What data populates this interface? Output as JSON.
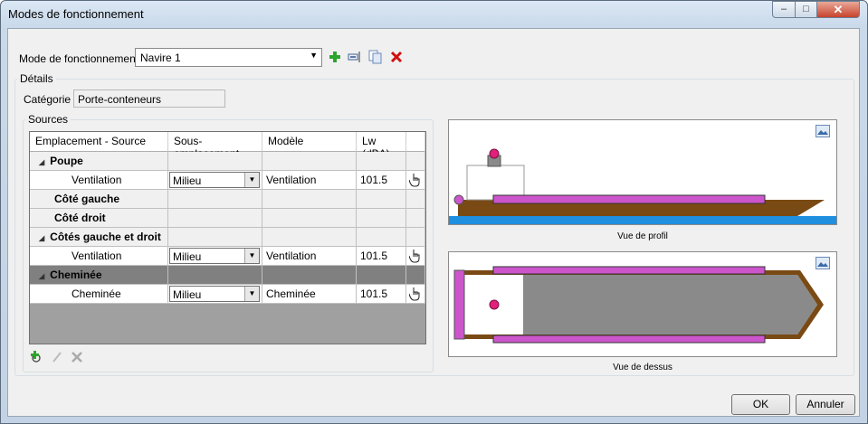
{
  "window": {
    "title": "Modes de fonctionnement",
    "min": "–",
    "max": "□",
    "close": "✕"
  },
  "mode": {
    "label": "Mode de fonctionnement",
    "value": "Navire  1"
  },
  "details": {
    "label": "Détails",
    "category_label": "Catégorie",
    "category_value": "Porte-conteneurs"
  },
  "sources": {
    "label": "Sources",
    "columns": [
      "Emplacement - Source",
      "Sous-emplacement",
      "Modèle",
      "Lw (dBA)"
    ],
    "rows": [
      {
        "kind": "group",
        "name": "Poupe",
        "expander": "◢"
      },
      {
        "kind": "item",
        "name": "Ventilation",
        "sub": "Milieu",
        "model": "Ventilation",
        "lw": "101.5"
      },
      {
        "kind": "group",
        "name": "Côté gauche",
        "expander": ""
      },
      {
        "kind": "group",
        "name": "Côté droit",
        "expander": ""
      },
      {
        "kind": "group",
        "name": "Côtés gauche et droit",
        "expander": "◢"
      },
      {
        "kind": "item",
        "name": "Ventilation",
        "sub": "Milieu",
        "model": "Ventilation",
        "lw": "101.5"
      },
      {
        "kind": "selected",
        "name": "Cheminée",
        "expander": "◢"
      },
      {
        "kind": "item",
        "name": "Cheminée",
        "sub": "Milieu",
        "model": "Cheminée",
        "lw": "101.5"
      }
    ]
  },
  "views": {
    "profile_caption": "Vue de profil",
    "top_caption": "Vue de dessus"
  },
  "footer": {
    "ok": "OK",
    "cancel": "Annuler"
  },
  "colors": {
    "hull": "#7a4a14",
    "deck": "#cc55cc",
    "water": "#1f8fe0",
    "source": "#e0207a"
  },
  "icons": {
    "add": "plus-icon",
    "rename": "rename-icon",
    "copy": "copy-icon",
    "delete": "delete-icon",
    "pointer": "hand-pointer-icon",
    "image": "image-icon"
  }
}
